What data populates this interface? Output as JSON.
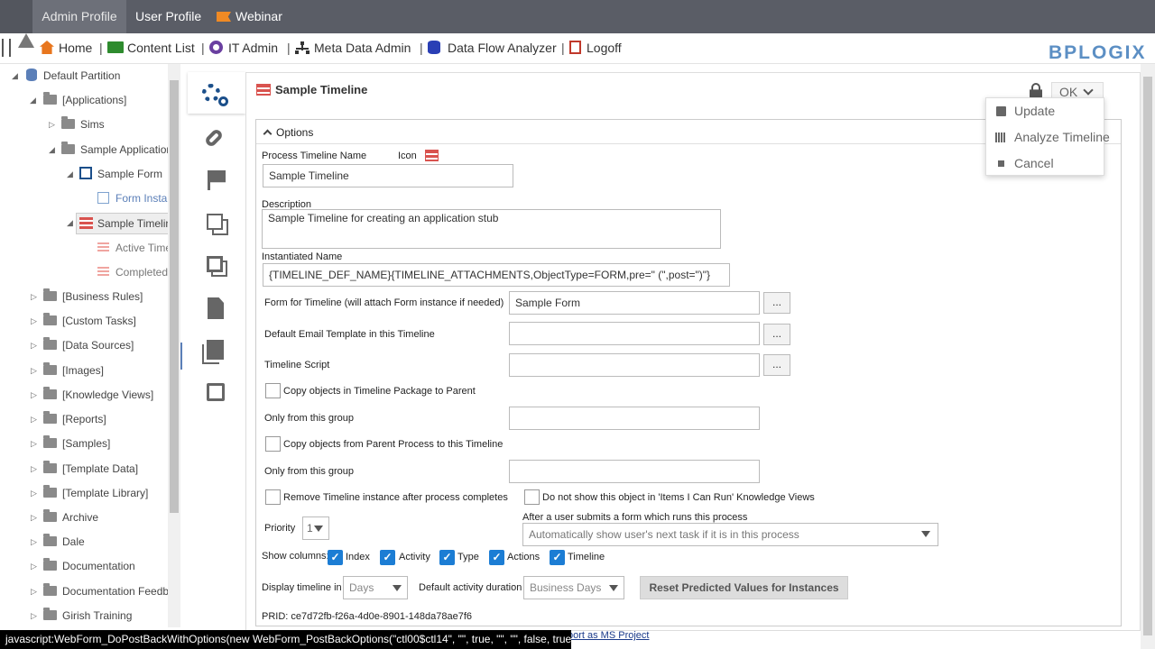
{
  "topbar": {
    "tabs": [
      "Admin Profile",
      "User Profile",
      "Webinar"
    ]
  },
  "nav": {
    "items": [
      "Home",
      "Content List",
      "IT Admin",
      "Meta Data Admin",
      "Data Flow Analyzer",
      "Logoff"
    ],
    "separator": "|"
  },
  "logo": "BPLOGIX",
  "tree": {
    "root": "Default Partition",
    "items": [
      "[Applications]",
      "Sims",
      "Sample Application",
      "Sample Form",
      "Form Instar",
      "Sample Timelin",
      "Active Time",
      "Completed",
      "[Business Rules]",
      "[Custom Tasks]",
      "[Data Sources]",
      "[Images]",
      "[Knowledge Views]",
      "[Reports]",
      "[Samples]",
      "[Template Data]",
      "[Template Library]",
      "Archive",
      "Dale",
      "Documentation",
      "Documentation Feedbac",
      "Girish Training"
    ]
  },
  "panel": {
    "title": "Sample Timeline",
    "ok_label": "OK",
    "options_label": "Options"
  },
  "form": {
    "name_label": "Process Timeline Name",
    "icon_label": "Icon",
    "name_value": "Sample Timeline",
    "desc_label": "Description",
    "desc_value": "Sample Timeline for creating an application stub",
    "inst_label": "Instantiated Name",
    "inst_value": "{TIMELINE_DEF_NAME}{TIMELINE_ATTACHMENTS,ObjectType=FORM,pre=\" (\",post=\")\"}",
    "form_label": "Form for Timeline (will attach Form instance if needed)",
    "form_value": "Sample Form",
    "email_label": "Default Email Template in this Timeline",
    "script_label": "Timeline Script",
    "ellipsis": "...",
    "copy_pkg_label": "Copy objects in Timeline Package to Parent",
    "only_group_label": "Only from this group",
    "copy_parent_label": "Copy objects from Parent Process to this Timeline",
    "only_group_label2": "Only from this group",
    "remove_label": "Remove Timeline instance after process completes",
    "notshow_label": "Do not show this object in 'Items I Can Run' Knowledge Views",
    "priority_label": "Priority",
    "priority_value": "1",
    "after_label": "After a user submits a form which runs this process",
    "after_value": "Automatically show user's next task if it is in this process",
    "show_columns_label": "Show columns:",
    "columns": [
      "Index",
      "Activity",
      "Type",
      "Actions",
      "Timeline"
    ],
    "display_label": "Display timeline in",
    "display_value": "Days",
    "duration_label": "Default activity duration",
    "duration_value": "Business Days",
    "reset_label": "Reset Predicted Values for Instances",
    "prid_label": "PRID:",
    "prid_value": "ce7d72fb-f26a-4d0e-8901-148da78ae7f6",
    "export_link": "port as MS Project"
  },
  "dropdown": {
    "items": [
      "Update",
      "Analyze Timeline",
      "Cancel"
    ]
  },
  "status_text": "javascript:WebForm_DoPostBackWithOptions(new WebForm_PostBackOptions(\"ctl00$ctl14\", \"\", true, \"\", \"\", false, true))",
  "colors": {
    "accent": "#1c7dd4",
    "topbar": "#5a5d66",
    "logo": "#5c8fc4"
  }
}
